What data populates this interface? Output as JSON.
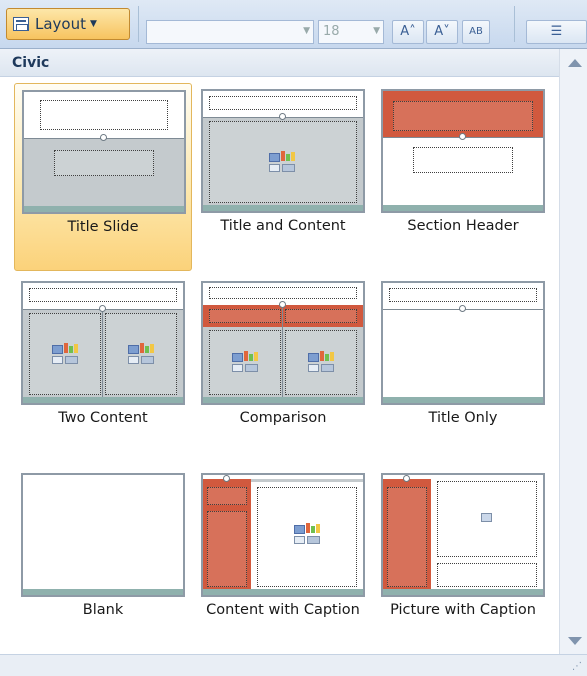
{
  "ribbon": {
    "layout_button": "Layout",
    "font_size": "18",
    "grow_font": "A˄",
    "shrink_font": "A˅",
    "clear_format": "AB",
    "bullets": "☰"
  },
  "gallery": {
    "theme_name": "Civic",
    "selected_layout": "Title Slide",
    "layouts": [
      {
        "label": "Title Slide"
      },
      {
        "label": "Title and Content"
      },
      {
        "label": "Section Header"
      },
      {
        "label": "Two Content"
      },
      {
        "label": "Comparison"
      },
      {
        "label": "Title Only"
      },
      {
        "label": "Blank"
      },
      {
        "label": "Content with Caption"
      },
      {
        "label": "Picture with Caption"
      }
    ]
  },
  "colors": {
    "accent_red": "#d1593e",
    "placeholder_gray": "#c4cacd",
    "selection_gold": "#fbd27a"
  },
  "icons": [
    "layout-icon",
    "chevron-down-icon",
    "scroll-up-icon",
    "scroll-down-icon",
    "content-insert-icon",
    "picture-icon",
    "resize-grip-icon"
  ]
}
